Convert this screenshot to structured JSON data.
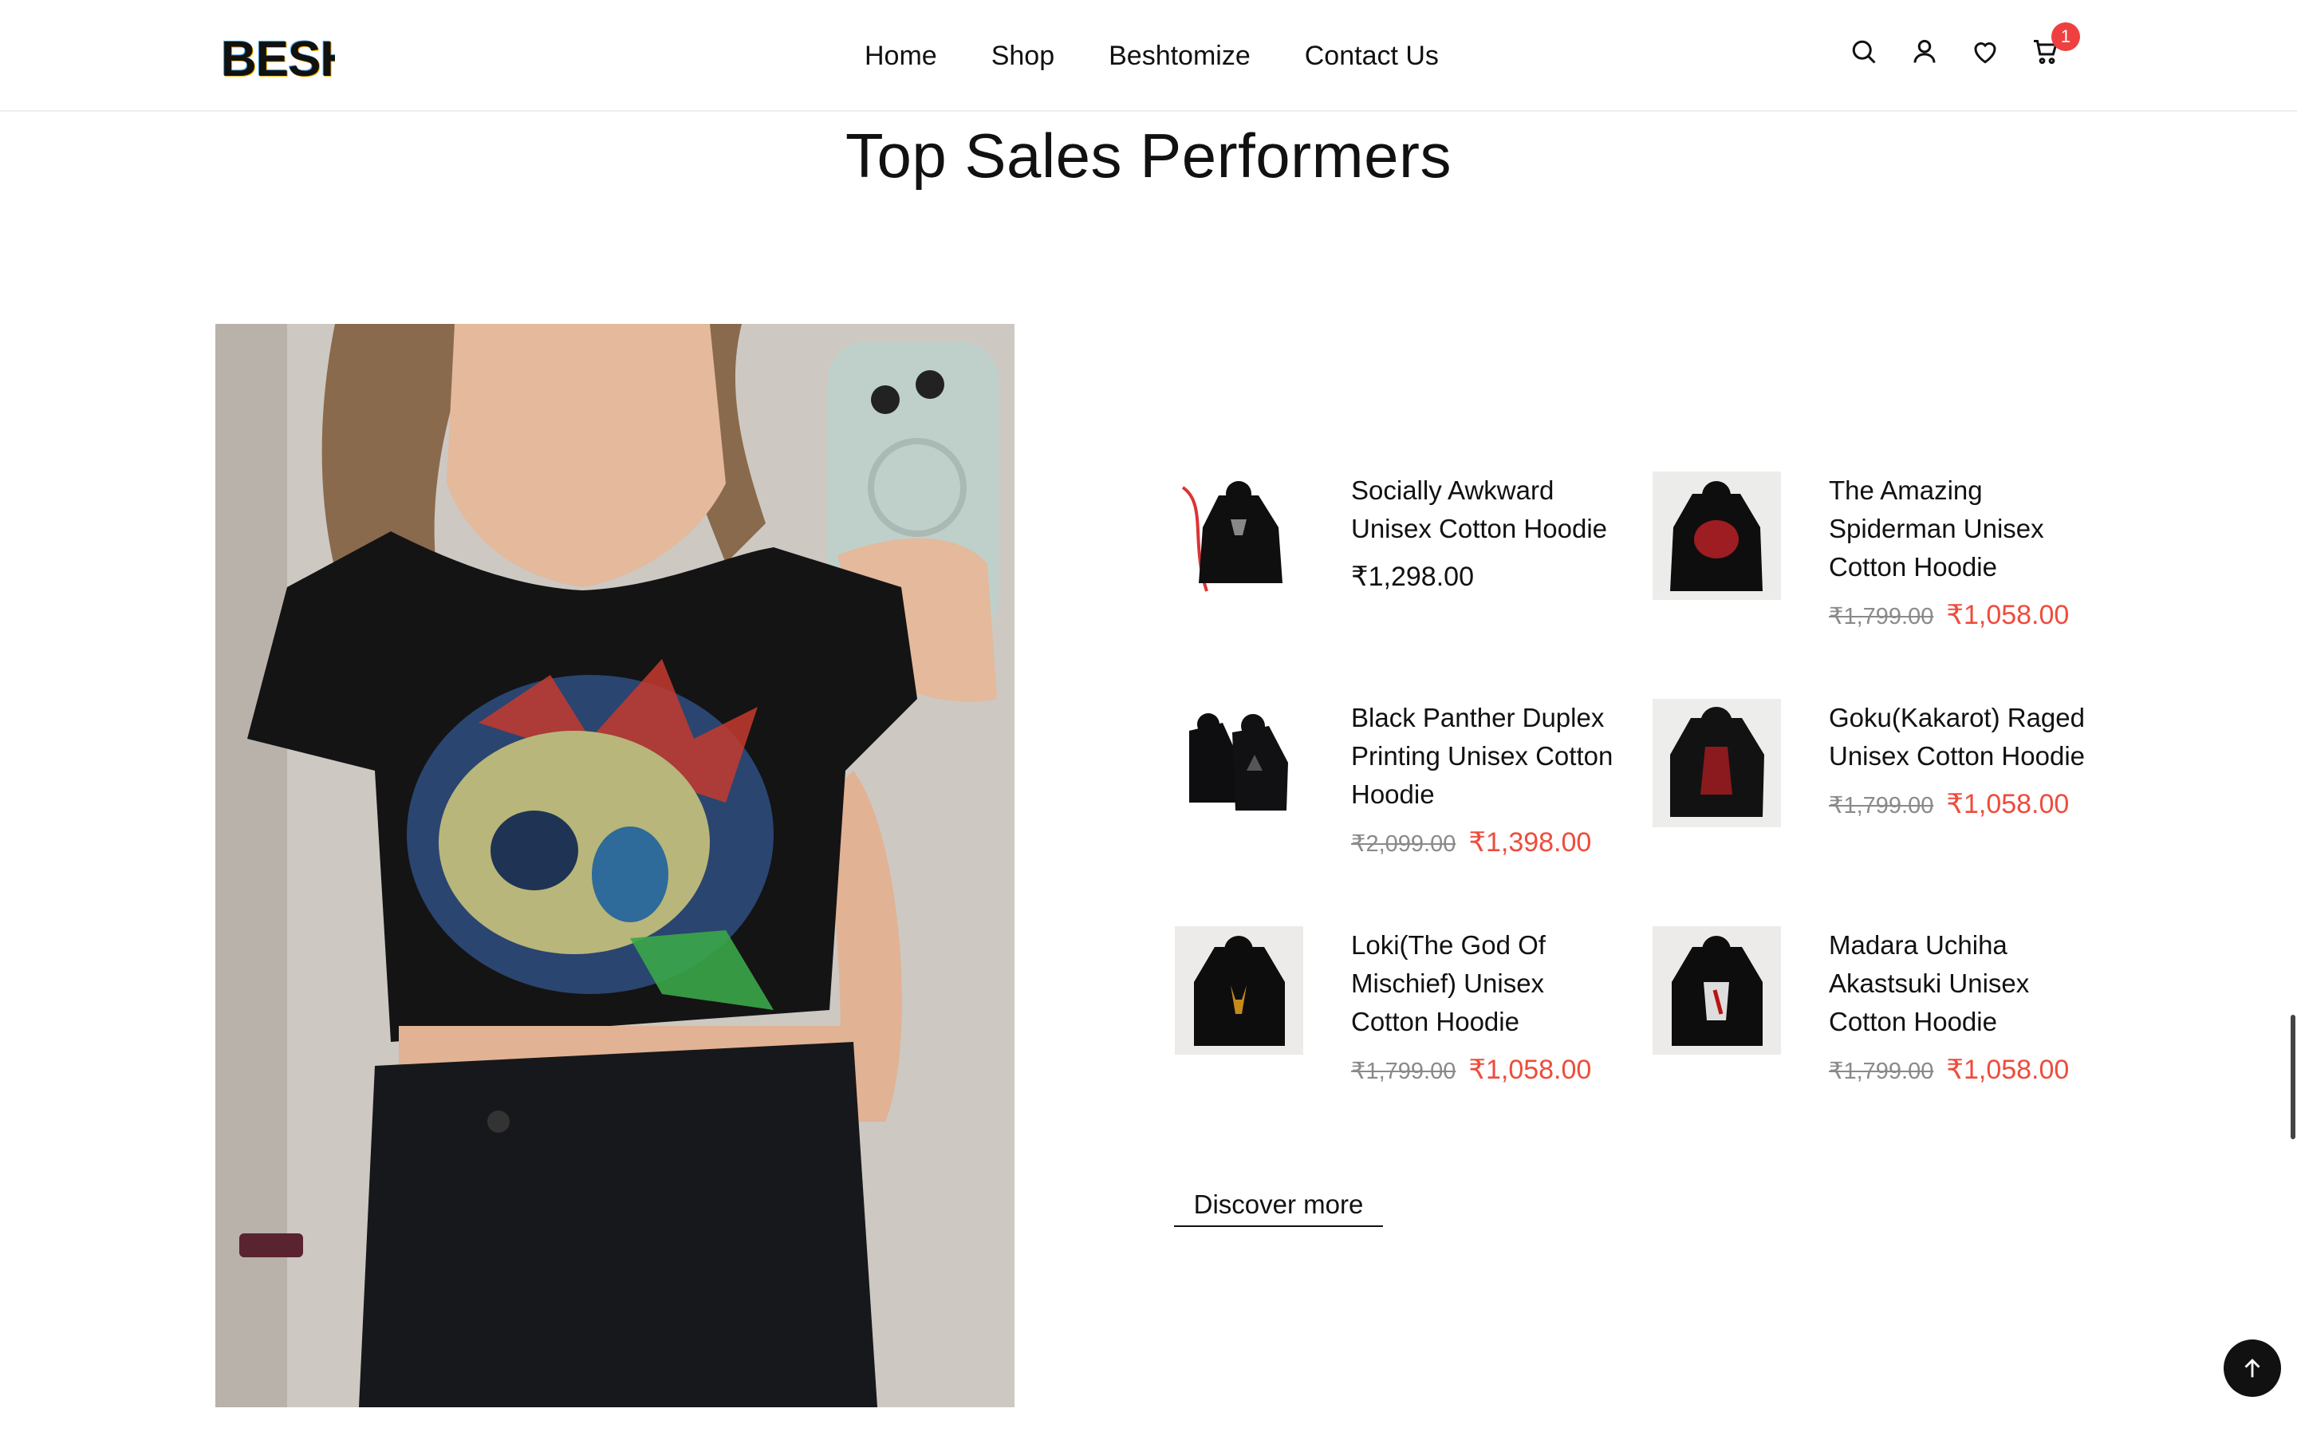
{
  "header": {
    "logo_text": "BESH",
    "nav": [
      "Home",
      "Shop",
      "Beshtomize",
      "Contact Us"
    ],
    "icons": [
      "search-icon",
      "user-icon",
      "heart-icon",
      "cart-icon"
    ],
    "cart_count": "1"
  },
  "section": {
    "title": "Top Sales Performers"
  },
  "products": [
    {
      "name": "Socially Awkward Unisex Cotton Hoodie",
      "old_price": "",
      "price": "₹1,298.00"
    },
    {
      "name": "The Amazing Spiderman Unisex Cotton Hoodie",
      "old_price": "₹1,799.00",
      "price": "₹1,058.00"
    },
    {
      "name": "Black Panther Duplex Printing Unisex Cotton Hoodie",
      "old_price": "₹2,099.00",
      "price": "₹1,398.00"
    },
    {
      "name": "Goku(Kakarot) Raged Unisex Cotton Hoodie",
      "old_price": "₹1,799.00",
      "price": "₹1,058.00"
    },
    {
      "name": "Loki(The God Of Mischief) Unisex Cotton Hoodie",
      "old_price": "₹1,799.00",
      "price": "₹1,058.00"
    },
    {
      "name": "Madara Uchiha Akastsuki Unisex Cotton Hoodie",
      "old_price": "₹1,799.00",
      "price": "₹1,058.00"
    }
  ],
  "discover_label": "Discover more",
  "colors": {
    "accent_price": "#ee4c3c",
    "badge": "#ee4040",
    "text": "#111111"
  }
}
